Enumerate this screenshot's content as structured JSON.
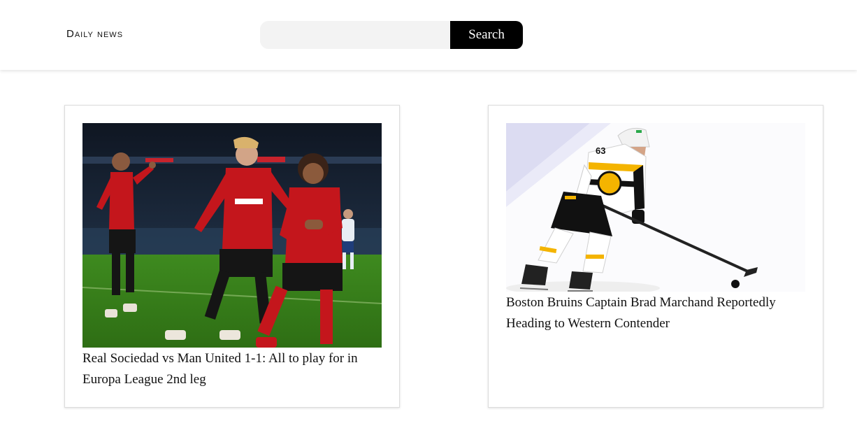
{
  "header": {
    "logo": "Daily news",
    "search": {
      "placeholder": "",
      "value": "",
      "button_label": "Search"
    }
  },
  "articles": [
    {
      "title": "Real Sociedad vs Man United 1-1: All to play for in Europa League 2nd leg"
    },
    {
      "title": "Boston Bruins Captain Brad Marchand Reportedly Heading to Western Contender"
    }
  ]
}
